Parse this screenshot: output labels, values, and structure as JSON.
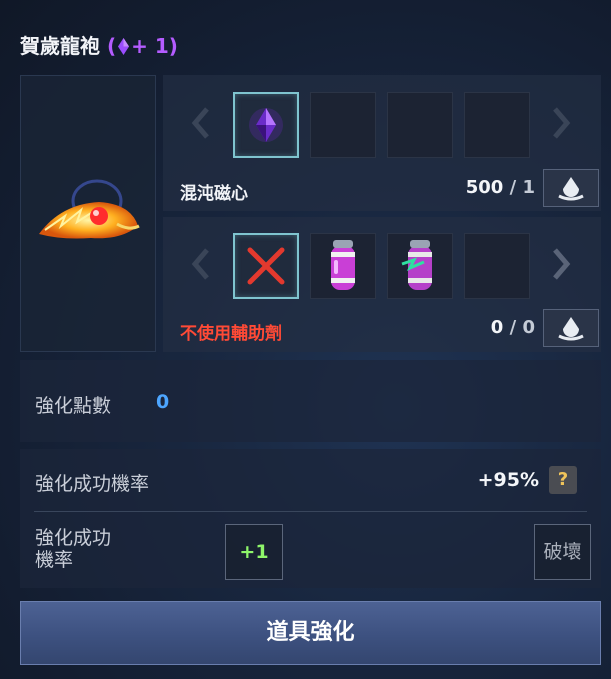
{
  "item": {
    "name": "賀歲龍袍",
    "enhance_prefix": "(",
    "enhance_level": "+ 1)"
  },
  "material": {
    "name": "混沌磁心",
    "owned": "500",
    "separator": "/",
    "required": "1"
  },
  "auxiliary": {
    "status": "不使用輔助劑",
    "owned": "0",
    "separator": "/",
    "required": "0"
  },
  "points": {
    "label": "強化點數",
    "value": "0"
  },
  "success_rate": {
    "label": "強化成功機率",
    "value": "+95%",
    "help": "?"
  },
  "success_result": {
    "label": "強化成功\n機率",
    "plus_label": "+1",
    "destroy_label": "破壞"
  },
  "action": {
    "enhance_label": "道具強化"
  },
  "colors": {
    "accent_purple": "#b45cff",
    "warning_red": "#ff4a36",
    "points_blue": "#4da6ff",
    "plus_green": "#8ef56a"
  }
}
